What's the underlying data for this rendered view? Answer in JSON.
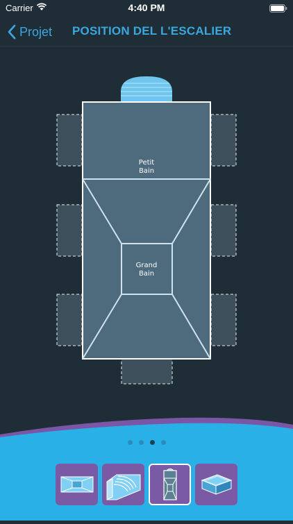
{
  "status": {
    "carrier": "Carrier",
    "time": "4:40 PM"
  },
  "nav": {
    "back_label": "Projet",
    "title": "POSITION DEL L'ESCALIER"
  },
  "pool": {
    "shallow_label_line1": "Petit",
    "shallow_label_line2": "Bain",
    "deep_label_line1": "Grand",
    "deep_label_line2": "Bain"
  },
  "pager": {
    "pages": 4,
    "current": 3
  },
  "tiles": [
    {
      "icon": "rectangular-pool-icon",
      "selected": false
    },
    {
      "icon": "roman-steps-icon",
      "selected": false
    },
    {
      "icon": "stair-position-icon",
      "selected": true
    },
    {
      "icon": "pool-3d-icon",
      "selected": false
    }
  ],
  "colors": {
    "accent": "#3aa7df",
    "background": "#1f2d36",
    "pool": "#4e6b7d",
    "panel": "#29b0e6",
    "tile": "#7a5aa5"
  }
}
